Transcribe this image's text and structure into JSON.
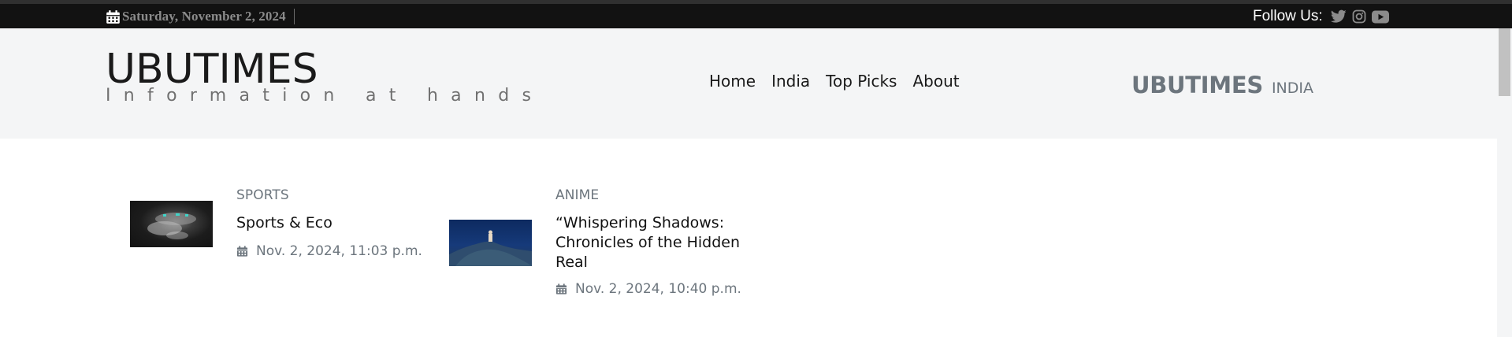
{
  "topbar": {
    "date": "Saturday, November 2, 2024",
    "calendar_icon": "calendar-icon",
    "follow_label": "Follow Us:",
    "social": [
      {
        "name": "twitter-icon"
      },
      {
        "name": "instagram-icon"
      },
      {
        "name": "youtube-icon"
      }
    ],
    "colors": {
      "background": "#121212",
      "date_text": "#8b8b8b",
      "follow_text": "#ffffff",
      "social_icon": "#8b8b8b"
    }
  },
  "header": {
    "brand_title": "UBUTIMES",
    "tagline": "Information at hands",
    "nav": [
      {
        "label": "Home"
      },
      {
        "label": "India"
      },
      {
        "label": "Top Picks"
      },
      {
        "label": "About"
      }
    ],
    "right_brand": "UBUTIMES",
    "right_brand_sub": "INDIA",
    "colors": {
      "background": "#f4f5f6",
      "text": "#1a1a1a",
      "muted": "#6c757d"
    }
  },
  "articles": [
    {
      "category": "SPORTS",
      "title": "Sports & Eco",
      "date": "Nov. 2, 2024, 11:03 p.m.",
      "thumbnail": "sports-thumbnail"
    },
    {
      "category": "ANIME",
      "title": "“Whispering Shadows: Chronicles of the Hidden Real",
      "date": "Nov. 2, 2024, 10:40 p.m.",
      "thumbnail": "anime-thumbnail"
    }
  ]
}
